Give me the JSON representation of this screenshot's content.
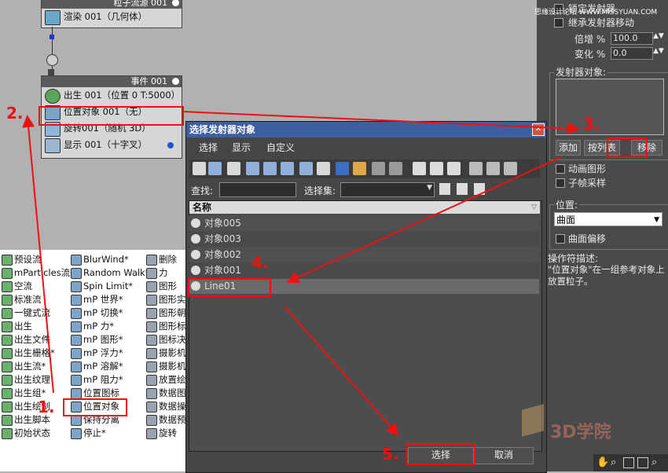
{
  "watermark": "思缘设计论坛 WWW.MISSYUAN.COM",
  "node_editor": {
    "source_node": {
      "title": "粒子流源 001",
      "render_op": "渲染 001（几何体）"
    },
    "event_node": {
      "title": "事件 001",
      "ops": [
        {
          "label": "出生 001（位置 0 T:5000）",
          "icon": "birth-icon"
        },
        {
          "label": "位置对象 001（无）",
          "icon": "position-object-icon"
        },
        {
          "label": "旋转001（随机 3D）",
          "icon": "rotation-icon"
        },
        {
          "label": "显示 001（十字叉）",
          "icon": "display-icon"
        }
      ]
    }
  },
  "depot": {
    "col1": [
      "预设流",
      "mParticles流*",
      "空流",
      "标准流",
      "一键式流",
      "出生",
      "出生文件",
      "出生栅格*",
      "出生流*",
      "出生纹理",
      "出生组*",
      "出生绘制",
      "出生脚本",
      "初始状态"
    ],
    "col2": [
      "BlurWind*",
      "Random Walk*",
      "Spin Limit*",
      "mP 世界*",
      "mP 切换*",
      "mP 力*",
      "mP 图形*",
      "mP 浮力*",
      "mP 溶解*",
      "mP 阻力*",
      "位置图标",
      "位置对象",
      "保持分离",
      "停止*"
    ],
    "col3": [
      "删除",
      "力",
      "图形",
      "图形实",
      "图形朝",
      "图形标",
      "图标决",
      "摄影机",
      "摄影机",
      "放置绘",
      "数据图",
      "数据操",
      "数据预",
      "旋转"
    ]
  },
  "dialog": {
    "title": "选择发射器对象",
    "menus": [
      "选择",
      "显示",
      "自定义"
    ],
    "find_label": "查找:",
    "selset_label": "选择集:",
    "column_header": "名称",
    "items": [
      "对象005",
      "对象003",
      "对象002",
      "对象001",
      "Line01"
    ],
    "select_button": "选择",
    "cancel_button": "取消"
  },
  "right_panel": {
    "lock_emitter": "锁定发射器",
    "inherit_motion": "继承发射器移动",
    "multiplier_label": "倍增 %",
    "multiplier_value": "100.0",
    "variation_label": "变化 %",
    "variation_value": "0.0",
    "emitter_objects_label": "发射器对象:",
    "add_button": "添加",
    "by_list_button": "按列表",
    "remove_button": "移除",
    "animated_shape": "动画图形",
    "subframe_sampling": "子帧采样",
    "location_label": "位置:",
    "location_value": "曲面",
    "surface_offset": "曲面偏移",
    "op_desc_label": "操作符描述:",
    "op_desc_text": "\"位置对象\"在一组参考对象上放置粒子。"
  },
  "annotations": {
    "step1": "1.",
    "step2": "2.",
    "step3": "3.",
    "step4": "4.",
    "step5": "5."
  },
  "logo_text": "3D学院",
  "colors": {
    "annotation": "#e11111",
    "dialog_title_bar": "#3e5f9e",
    "selected_row": "#6a6a6a"
  }
}
